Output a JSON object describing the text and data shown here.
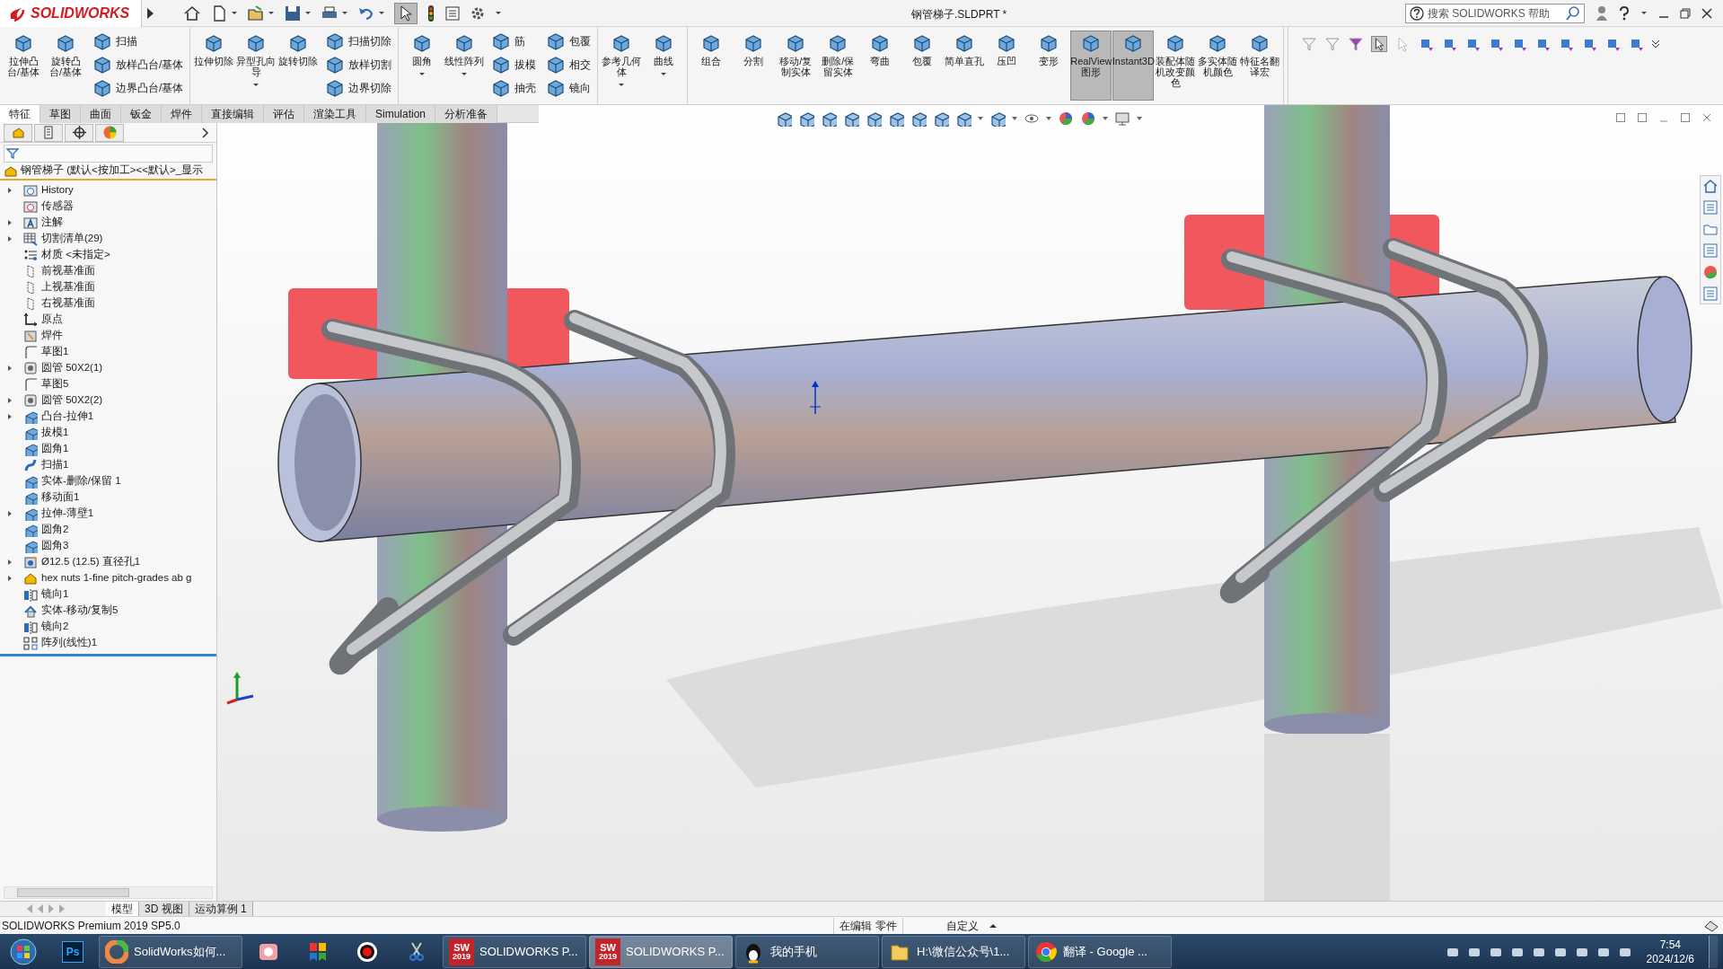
{
  "title_bar": {
    "brand": "SOLIDWORKS",
    "document_title": "钢管梯子.SLDPRT *",
    "search": {
      "placeholder": "搜索 SOLIDWORKS 帮助"
    }
  },
  "command_groups": [
    {
      "buttons": [
        {
          "label": "拉伸凸台/基体",
          "menu": false,
          "on": false
        },
        {
          "label": "旋转凸台/基体",
          "menu": false,
          "on": false
        }
      ],
      "small_buttons": [
        {
          "label": "扫描"
        },
        {
          "label": "放样凸台/基体"
        },
        {
          "label": "边界凸台/基体"
        }
      ]
    },
    {
      "buttons": [
        {
          "label": "拉伸切除",
          "menu": false,
          "on": false
        },
        {
          "label": "异型孔向导",
          "menu": true,
          "on": false
        },
        {
          "label": "旋转切除",
          "menu": false,
          "on": false
        }
      ],
      "small_buttons": [
        {
          "label": "扫描切除"
        },
        {
          "label": "放样切割"
        },
        {
          "label": "边界切除"
        }
      ]
    },
    {
      "buttons": [
        {
          "label": "圆角",
          "menu": true,
          "on": false
        },
        {
          "label": "线性阵列",
          "menu": true,
          "on": false
        }
      ],
      "small_buttons": [
        {
          "label": "筋"
        },
        {
          "label": "拔模"
        },
        {
          "label": "抽壳"
        },
        {
          "label": "包覆"
        },
        {
          "label": "相交"
        },
        {
          "label": "镜向"
        }
      ]
    },
    {
      "buttons": [
        {
          "label": "参考几何体",
          "menu": true,
          "on": false
        },
        {
          "label": "曲线",
          "menu": true,
          "on": false
        }
      ]
    },
    {
      "buttons": [
        {
          "label": "组合",
          "menu": false,
          "on": false
        },
        {
          "label": "分割",
          "menu": false,
          "on": false
        },
        {
          "label": "移动/复制实体",
          "menu": false,
          "on": false
        },
        {
          "label": "删除/保留实体",
          "menu": false,
          "on": false
        },
        {
          "label": "弯曲",
          "menu": false,
          "on": false
        },
        {
          "label": "包覆",
          "menu": false,
          "on": false
        },
        {
          "label": "简单直孔",
          "menu": false,
          "on": false
        },
        {
          "label": "压凹",
          "menu": false,
          "on": false
        },
        {
          "label": "变形",
          "menu": false,
          "on": false
        },
        {
          "label": "RealView图形",
          "menu": false,
          "on": true
        },
        {
          "label": "Instant3D",
          "menu": false,
          "on": true
        },
        {
          "label": "装配体随机改变颜色",
          "menu": false,
          "on": false
        },
        {
          "label": "多实体随机颜色",
          "menu": false,
          "on": false
        },
        {
          "label": "特征名翻译宏",
          "menu": false,
          "on": false
        }
      ]
    }
  ],
  "command_tabs": [
    {
      "label": "特征",
      "selected": true
    },
    {
      "label": "草图",
      "selected": false
    },
    {
      "label": "曲面",
      "selected": false
    },
    {
      "label": "钣金",
      "selected": false
    },
    {
      "label": "焊件",
      "selected": false
    },
    {
      "label": "直接编辑",
      "selected": false
    },
    {
      "label": "评估",
      "selected": false
    },
    {
      "label": "渲染工具",
      "selected": false
    },
    {
      "label": "Simulation",
      "selected": false
    },
    {
      "label": "分析准备",
      "selected": false
    }
  ],
  "feature_tree": {
    "root": "钢管梯子  (默认<按加工><<默认>_显示",
    "items": [
      {
        "label": "History",
        "expandable": true
      },
      {
        "label": "传感器",
        "expandable": false
      },
      {
        "label": "注解",
        "expandable": true
      },
      {
        "label": "切割清单(29)",
        "expandable": true
      },
      {
        "label": "材质 <未指定>",
        "expandable": false
      },
      {
        "label": "前视基准面",
        "expandable": false
      },
      {
        "label": "上视基准面",
        "expandable": false
      },
      {
        "label": "右视基准面",
        "expandable": false
      },
      {
        "label": "原点",
        "expandable": false
      },
      {
        "label": "焊件",
        "expandable": false
      },
      {
        "label": "草图1",
        "expandable": false
      },
      {
        "label": "圆管 50X2(1)",
        "expandable": true
      },
      {
        "label": "草图5",
        "expandable": false
      },
      {
        "label": "圆管 50X2(2)",
        "expandable": true
      },
      {
        "label": "凸台-拉伸1",
        "expandable": true
      },
      {
        "label": "拔模1",
        "expandable": false
      },
      {
        "label": "圆角1",
        "expandable": false
      },
      {
        "label": "扫描1",
        "expandable": false
      },
      {
        "label": "实体-删除/保留 1",
        "expandable": false
      },
      {
        "label": "移动面1",
        "expandable": false
      },
      {
        "label": "拉伸-薄壁1",
        "expandable": true
      },
      {
        "label": "圆角2",
        "expandable": false
      },
      {
        "label": "圆角3",
        "expandable": false
      },
      {
        "label": "Ø12.5 (12.5) 直径孔1",
        "expandable": true
      },
      {
        "label": "hex nuts 1-fine pitch-grades ab g",
        "expandable": true
      },
      {
        "label": "镜向1",
        "expandable": false
      },
      {
        "label": "实体-移动/复制5",
        "expandable": false
      },
      {
        "label": "镜向2",
        "expandable": false
      },
      {
        "label": "阵列(线性)1",
        "expandable": false
      }
    ]
  },
  "model_tabs": [
    {
      "label": "模型",
      "selected": true
    },
    {
      "label": "3D 视图",
      "selected": false
    },
    {
      "label": "运动算例 1",
      "selected": false
    }
  ],
  "status_bar": {
    "product": "SOLIDWORKS Premium 2019 SP5.0",
    "mode": "在编辑 零件",
    "units": "自定义"
  },
  "taskbar": {
    "items": [
      {
        "kind": "icon",
        "icon_text": "Ps",
        "active": false
      },
      {
        "kind": "window",
        "label": "SolidWorks如何...",
        "active": false
      },
      {
        "kind": "icon",
        "active": false
      },
      {
        "kind": "icon",
        "active": false
      },
      {
        "kind": "icon",
        "active": false
      },
      {
        "kind": "icon",
        "active": false
      },
      {
        "kind": "window",
        "icon_text": "SW",
        "badge": "2019",
        "label": "SOLIDWORKS P...",
        "active": false
      },
      {
        "kind": "window",
        "icon_text": "SW",
        "badge": "2019",
        "label": "SOLIDWORKS P...",
        "active": true
      },
      {
        "kind": "window",
        "label": "我的手机",
        "active": false
      },
      {
        "kind": "window",
        "label": "H:\\微信公众号\\1...",
        "active": false
      },
      {
        "kind": "window",
        "label": "翻译 - Google ...",
        "active": false
      }
    ],
    "time": "7:54",
    "date": "2024/12/6"
  }
}
